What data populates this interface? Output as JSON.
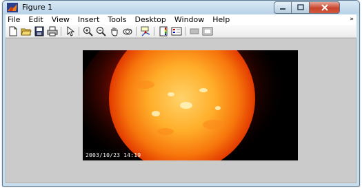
{
  "window": {
    "title": "Figure 1",
    "controls": {
      "minimize_icon": "minimize-icon",
      "maximize_icon": "maximize-icon",
      "close_icon": "close-icon"
    }
  },
  "menubar": {
    "items": [
      "File",
      "Edit",
      "View",
      "Insert",
      "Tools",
      "Desktop",
      "Window",
      "Help"
    ],
    "overflow_icon": "chevron-double-right-icon"
  },
  "toolbar": {
    "icons": [
      "new-figure-icon",
      "open-file-icon",
      "save-icon",
      "print-icon",
      "edit-plot-icon",
      "zoom-in-icon",
      "zoom-out-icon",
      "pan-icon",
      "rotate-3d-icon",
      "data-cursor-icon",
      "colorbar-icon",
      "legend-icon",
      "hide-plot-tools-icon",
      "show-plot-tools-icon"
    ]
  },
  "figure": {
    "image_caption": "2003/10/23  14:19",
    "colors": {
      "canvas": "#cbcbcb",
      "image_background": "#000000",
      "sun_core": "#ffd36a",
      "sun_edge": "#e23a00"
    }
  }
}
